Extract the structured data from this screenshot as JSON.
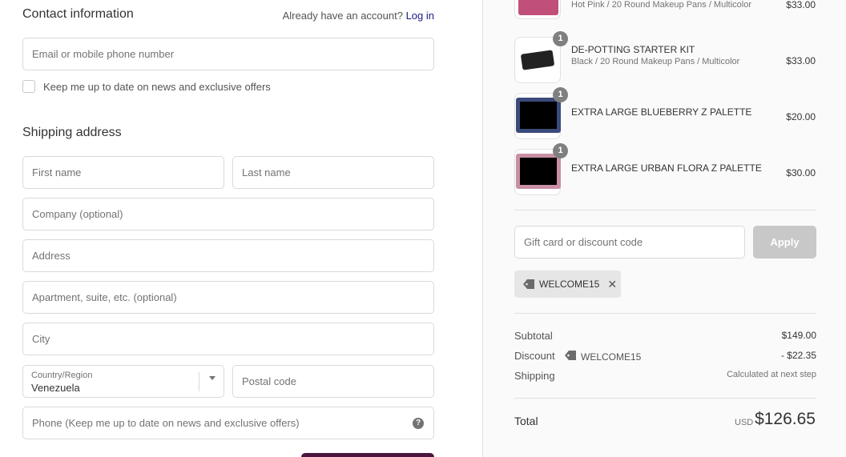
{
  "contact": {
    "title": "Contact information",
    "account_prompt": "Already have an account?",
    "login_link": "Log in",
    "email_placeholder": "Email or mobile phone number",
    "newsletter_label": "Keep me up to date on news and exclusive offers"
  },
  "shipping": {
    "title": "Shipping address",
    "first_name_placeholder": "First name",
    "last_name_placeholder": "Last name",
    "company_placeholder": "Company (optional)",
    "address_placeholder": "Address",
    "apartment_placeholder": "Apartment, suite, etc. (optional)",
    "city_placeholder": "City",
    "country_label": "Country/Region",
    "country_value": "Venezuela",
    "postal_placeholder": "Postal code",
    "phone_placeholder": "Phone (Keep me up to date on news and exclusive offers)",
    "help_glyph": "?"
  },
  "products": [
    {
      "name": "",
      "variant": "Hot Pink / 20 Round Makeup Pans / Multicolor",
      "price": "$33.00",
      "qty": "",
      "thumb_color": "#c0507a"
    },
    {
      "name": "DE-POTTING STARTER KIT",
      "variant": "Black / 20 Round Makeup Pans / Multicolor",
      "price": "$33.00",
      "qty": "1",
      "thumb_color": "#222222"
    },
    {
      "name": "EXTRA LARGE BLUEBERRY Z PALETTE",
      "variant": "",
      "price": "$20.00",
      "qty": "1",
      "thumb_color": "#3a4a7a"
    },
    {
      "name": "EXTRA LARGE URBAN FLORA Z PALETTE",
      "variant": "",
      "price": "$30.00",
      "qty": "1",
      "thumb_color": "#c88fa5"
    }
  ],
  "discount": {
    "input_placeholder": "Gift card or discount code",
    "apply_label": "Apply",
    "applied_code": "WELCOME15",
    "remove_glyph": "✕"
  },
  "summary": {
    "subtotal_label": "Subtotal",
    "subtotal_value": "$149.00",
    "discount_label": "Discount",
    "discount_code": "WELCOME15",
    "discount_value": "- $22.35",
    "shipping_label": "Shipping",
    "shipping_value": "Calculated at next step",
    "total_label": "Total",
    "currency": "USD",
    "total_value": "$126.65"
  },
  "colors": {
    "accent_button": "#4a1640",
    "link": "#1a1a8a",
    "apply_disabled": "#c8c8c8"
  }
}
